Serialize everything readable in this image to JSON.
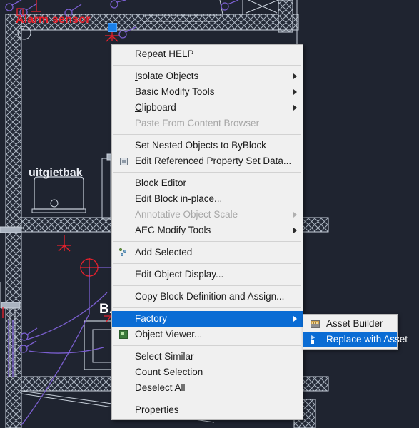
{
  "application": {
    "type": "cad-drawing-editor",
    "theme": "dark",
    "canvas_background": "#1f2430"
  },
  "drawing": {
    "labels": [
      "Alarm sensor",
      "uitgietbak",
      "BAI"
    ],
    "label_colors": [
      "#e8212c",
      "#e9ecf2",
      "#ffffff"
    ],
    "geometry_color": "#c9d1db",
    "electrical_symbol_color": "#e8212c",
    "wiring_color": "#7b5fd0",
    "selection_grip_color": "#1a7fe8"
  },
  "menu": {
    "name": "context-menu",
    "background": "#f0f0f0",
    "text_color": "#1b1b1b",
    "disabled_text_color": "#a6a6a6",
    "highlight_color": "#0a6cd4",
    "items": [
      {
        "label": "Repeat HELP",
        "mnemonic": "R",
        "enabled": true,
        "submenu": false,
        "icon": null
      },
      {
        "label": "Isolate Objects",
        "mnemonic": "I",
        "enabled": true,
        "submenu": true,
        "icon": null
      },
      {
        "label": "Basic Modify Tools",
        "mnemonic": "B",
        "enabled": true,
        "submenu": true,
        "icon": null
      },
      {
        "label": "Clipboard",
        "mnemonic": "C",
        "enabled": true,
        "submenu": true,
        "icon": null
      },
      {
        "label": "Paste From Content Browser",
        "mnemonic": null,
        "enabled": false,
        "submenu": false,
        "icon": null
      },
      {
        "label": "Set Nested Objects to ByBlock",
        "mnemonic": null,
        "enabled": true,
        "submenu": false,
        "icon": null
      },
      {
        "label": "Edit Referenced Property Set Data...",
        "mnemonic": null,
        "enabled": true,
        "submenu": false,
        "icon": "property-set-icon"
      },
      {
        "label": "Block Editor",
        "mnemonic": null,
        "enabled": true,
        "submenu": false,
        "icon": null
      },
      {
        "label": "Edit Block in-place...",
        "mnemonic": null,
        "enabled": true,
        "submenu": false,
        "icon": null
      },
      {
        "label": "Annotative Object Scale",
        "mnemonic": null,
        "enabled": false,
        "submenu": true,
        "icon": null
      },
      {
        "label": "AEC Modify Tools",
        "mnemonic": null,
        "enabled": true,
        "submenu": true,
        "icon": null
      },
      {
        "label": "Add Selected",
        "mnemonic": null,
        "enabled": true,
        "submenu": false,
        "icon": "add-selected-icon"
      },
      {
        "label": "Edit Object Display...",
        "mnemonic": null,
        "enabled": true,
        "submenu": false,
        "icon": null
      },
      {
        "label": "Copy Block Definition and Assign...",
        "mnemonic": null,
        "enabled": true,
        "submenu": false,
        "icon": null
      },
      {
        "label": "Factory",
        "mnemonic": null,
        "enabled": true,
        "submenu": true,
        "icon": null,
        "highlighted": true
      },
      {
        "label": "Object Viewer...",
        "mnemonic": null,
        "enabled": true,
        "submenu": false,
        "icon": "object-viewer-icon"
      },
      {
        "label": "Select Similar",
        "mnemonic": null,
        "enabled": true,
        "submenu": false,
        "icon": null
      },
      {
        "label": "Count Selection",
        "mnemonic": null,
        "enabled": true,
        "submenu": false,
        "icon": null
      },
      {
        "label": "Deselect All",
        "mnemonic": null,
        "enabled": true,
        "submenu": false,
        "icon": null
      },
      {
        "label": "Properties",
        "mnemonic": null,
        "enabled": true,
        "submenu": false,
        "icon": null
      }
    ],
    "separator_after_indices": [
      0,
      4,
      6,
      10,
      11,
      12,
      13,
      15,
      18
    ]
  },
  "submenu": {
    "parent": "Factory",
    "background": "#f0f0f0",
    "highlight_color": "#0a6cd4",
    "items": [
      {
        "label": "Asset Builder",
        "enabled": true,
        "icon": "asset-builder-icon",
        "highlighted": false
      },
      {
        "label": "Replace with Asset",
        "enabled": true,
        "icon": "replace-with-asset-icon",
        "highlighted": true
      }
    ]
  }
}
